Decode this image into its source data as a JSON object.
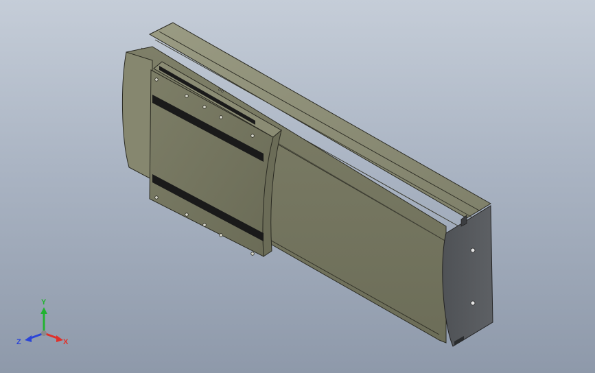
{
  "viewport": {
    "background_top": "#c5cdd8",
    "background_bottom": "#8e99aa"
  },
  "model": {
    "body_color": "#7b7c66",
    "end_cap_color": "#55585c",
    "carriage_color": "#76775f",
    "slot_color": "#1a1a1a"
  },
  "triad": {
    "x_label": "X",
    "y_label": "Y",
    "z_label": "Z",
    "x_color": "#e0302a",
    "y_color": "#22b330",
    "z_color": "#2a44d8"
  }
}
